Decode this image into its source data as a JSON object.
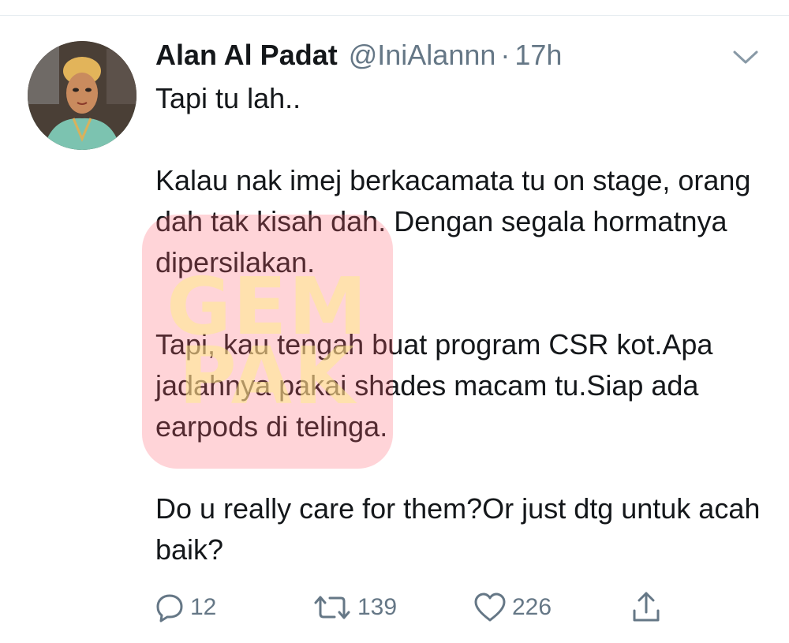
{
  "tweet": {
    "display_name": "Alan Al Padat",
    "handle": "@IniAlannn",
    "separator": "·",
    "time": "17h",
    "paragraphs": [
      "Tapi tu lah..",
      "Kalau nak imej berkacamata tu on stage, orang dah tak kisah dah. Dengan segala hormatnya dipersilakan.",
      "Tapi, kau tengah buat program CSR kot.Apa jadahnya pakai shades macam tu.Siap ada earpods di telinga.",
      "Do u really care for them?Or just dtg untuk acah baik?"
    ],
    "watermark": "GEM\nPAK"
  },
  "actions": {
    "reply": {
      "icon": "reply-icon",
      "count": "12"
    },
    "retweet": {
      "icon": "retweet-icon",
      "count": "139"
    },
    "like": {
      "icon": "heart-icon",
      "count": "226"
    },
    "share": {
      "icon": "share-icon"
    }
  },
  "colors": {
    "text": "#14171a",
    "secondary": "#657786",
    "divider": "#e6ecf0",
    "watermark": "#ff5f6e"
  }
}
